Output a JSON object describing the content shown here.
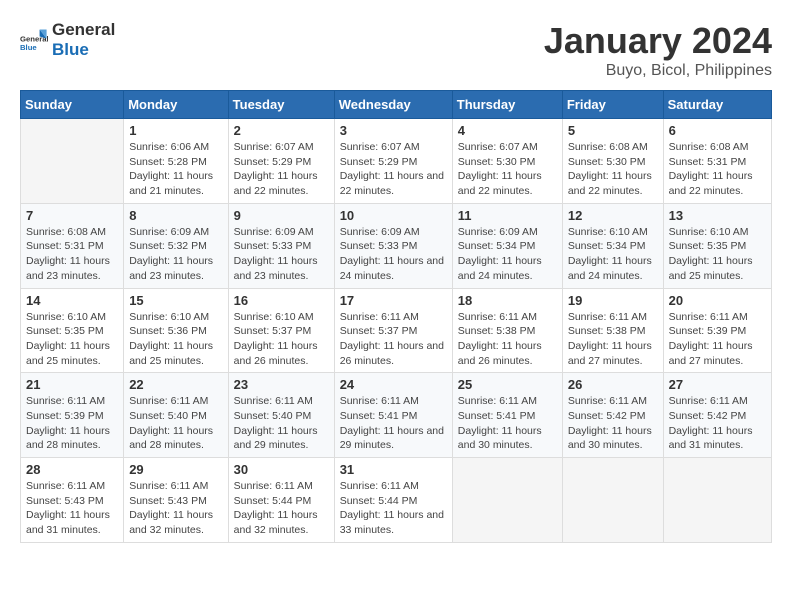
{
  "header": {
    "logo_general": "General",
    "logo_blue": "Blue",
    "month_title": "January 2024",
    "location": "Buyo, Bicol, Philippines"
  },
  "weekdays": [
    "Sunday",
    "Monday",
    "Tuesday",
    "Wednesday",
    "Thursday",
    "Friday",
    "Saturday"
  ],
  "weeks": [
    [
      {
        "day": "",
        "sunrise": "",
        "sunset": "",
        "daylight": ""
      },
      {
        "day": "1",
        "sunrise": "Sunrise: 6:06 AM",
        "sunset": "Sunset: 5:28 PM",
        "daylight": "Daylight: 11 hours and 21 minutes."
      },
      {
        "day": "2",
        "sunrise": "Sunrise: 6:07 AM",
        "sunset": "Sunset: 5:29 PM",
        "daylight": "Daylight: 11 hours and 22 minutes."
      },
      {
        "day": "3",
        "sunrise": "Sunrise: 6:07 AM",
        "sunset": "Sunset: 5:29 PM",
        "daylight": "Daylight: 11 hours and 22 minutes."
      },
      {
        "day": "4",
        "sunrise": "Sunrise: 6:07 AM",
        "sunset": "Sunset: 5:30 PM",
        "daylight": "Daylight: 11 hours and 22 minutes."
      },
      {
        "day": "5",
        "sunrise": "Sunrise: 6:08 AM",
        "sunset": "Sunset: 5:30 PM",
        "daylight": "Daylight: 11 hours and 22 minutes."
      },
      {
        "day": "6",
        "sunrise": "Sunrise: 6:08 AM",
        "sunset": "Sunset: 5:31 PM",
        "daylight": "Daylight: 11 hours and 22 minutes."
      }
    ],
    [
      {
        "day": "7",
        "sunrise": "Sunrise: 6:08 AM",
        "sunset": "Sunset: 5:31 PM",
        "daylight": "Daylight: 11 hours and 23 minutes."
      },
      {
        "day": "8",
        "sunrise": "Sunrise: 6:09 AM",
        "sunset": "Sunset: 5:32 PM",
        "daylight": "Daylight: 11 hours and 23 minutes."
      },
      {
        "day": "9",
        "sunrise": "Sunrise: 6:09 AM",
        "sunset": "Sunset: 5:33 PM",
        "daylight": "Daylight: 11 hours and 23 minutes."
      },
      {
        "day": "10",
        "sunrise": "Sunrise: 6:09 AM",
        "sunset": "Sunset: 5:33 PM",
        "daylight": "Daylight: 11 hours and 24 minutes."
      },
      {
        "day": "11",
        "sunrise": "Sunrise: 6:09 AM",
        "sunset": "Sunset: 5:34 PM",
        "daylight": "Daylight: 11 hours and 24 minutes."
      },
      {
        "day": "12",
        "sunrise": "Sunrise: 6:10 AM",
        "sunset": "Sunset: 5:34 PM",
        "daylight": "Daylight: 11 hours and 24 minutes."
      },
      {
        "day": "13",
        "sunrise": "Sunrise: 6:10 AM",
        "sunset": "Sunset: 5:35 PM",
        "daylight": "Daylight: 11 hours and 25 minutes."
      }
    ],
    [
      {
        "day": "14",
        "sunrise": "Sunrise: 6:10 AM",
        "sunset": "Sunset: 5:35 PM",
        "daylight": "Daylight: 11 hours and 25 minutes."
      },
      {
        "day": "15",
        "sunrise": "Sunrise: 6:10 AM",
        "sunset": "Sunset: 5:36 PM",
        "daylight": "Daylight: 11 hours and 25 minutes."
      },
      {
        "day": "16",
        "sunrise": "Sunrise: 6:10 AM",
        "sunset": "Sunset: 5:37 PM",
        "daylight": "Daylight: 11 hours and 26 minutes."
      },
      {
        "day": "17",
        "sunrise": "Sunrise: 6:11 AM",
        "sunset": "Sunset: 5:37 PM",
        "daylight": "Daylight: 11 hours and 26 minutes."
      },
      {
        "day": "18",
        "sunrise": "Sunrise: 6:11 AM",
        "sunset": "Sunset: 5:38 PM",
        "daylight": "Daylight: 11 hours and 26 minutes."
      },
      {
        "day": "19",
        "sunrise": "Sunrise: 6:11 AM",
        "sunset": "Sunset: 5:38 PM",
        "daylight": "Daylight: 11 hours and 27 minutes."
      },
      {
        "day": "20",
        "sunrise": "Sunrise: 6:11 AM",
        "sunset": "Sunset: 5:39 PM",
        "daylight": "Daylight: 11 hours and 27 minutes."
      }
    ],
    [
      {
        "day": "21",
        "sunrise": "Sunrise: 6:11 AM",
        "sunset": "Sunset: 5:39 PM",
        "daylight": "Daylight: 11 hours and 28 minutes."
      },
      {
        "day": "22",
        "sunrise": "Sunrise: 6:11 AM",
        "sunset": "Sunset: 5:40 PM",
        "daylight": "Daylight: 11 hours and 28 minutes."
      },
      {
        "day": "23",
        "sunrise": "Sunrise: 6:11 AM",
        "sunset": "Sunset: 5:40 PM",
        "daylight": "Daylight: 11 hours and 29 minutes."
      },
      {
        "day": "24",
        "sunrise": "Sunrise: 6:11 AM",
        "sunset": "Sunset: 5:41 PM",
        "daylight": "Daylight: 11 hours and 29 minutes."
      },
      {
        "day": "25",
        "sunrise": "Sunrise: 6:11 AM",
        "sunset": "Sunset: 5:41 PM",
        "daylight": "Daylight: 11 hours and 30 minutes."
      },
      {
        "day": "26",
        "sunrise": "Sunrise: 6:11 AM",
        "sunset": "Sunset: 5:42 PM",
        "daylight": "Daylight: 11 hours and 30 minutes."
      },
      {
        "day": "27",
        "sunrise": "Sunrise: 6:11 AM",
        "sunset": "Sunset: 5:42 PM",
        "daylight": "Daylight: 11 hours and 31 minutes."
      }
    ],
    [
      {
        "day": "28",
        "sunrise": "Sunrise: 6:11 AM",
        "sunset": "Sunset: 5:43 PM",
        "daylight": "Daylight: 11 hours and 31 minutes."
      },
      {
        "day": "29",
        "sunrise": "Sunrise: 6:11 AM",
        "sunset": "Sunset: 5:43 PM",
        "daylight": "Daylight: 11 hours and 32 minutes."
      },
      {
        "day": "30",
        "sunrise": "Sunrise: 6:11 AM",
        "sunset": "Sunset: 5:44 PM",
        "daylight": "Daylight: 11 hours and 32 minutes."
      },
      {
        "day": "31",
        "sunrise": "Sunrise: 6:11 AM",
        "sunset": "Sunset: 5:44 PM",
        "daylight": "Daylight: 11 hours and 33 minutes."
      },
      {
        "day": "",
        "sunrise": "",
        "sunset": "",
        "daylight": ""
      },
      {
        "day": "",
        "sunrise": "",
        "sunset": "",
        "daylight": ""
      },
      {
        "day": "",
        "sunrise": "",
        "sunset": "",
        "daylight": ""
      }
    ]
  ]
}
